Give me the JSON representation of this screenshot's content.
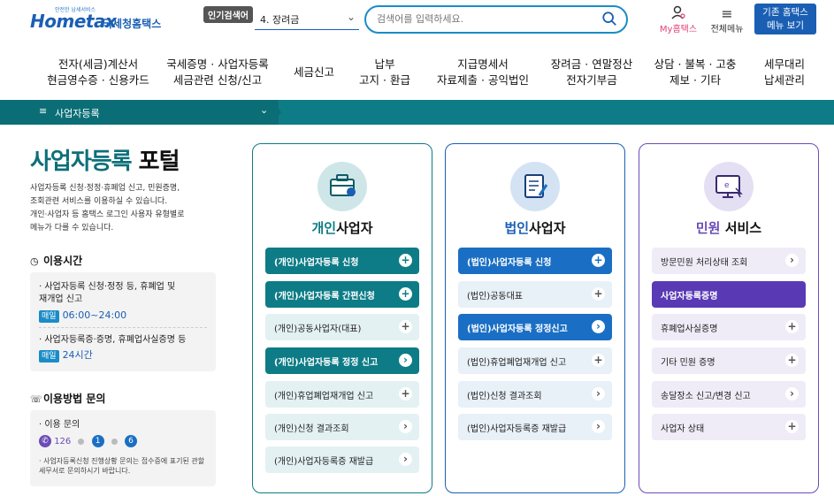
{
  "header": {
    "logo_tiny": "안전한 납세서비스",
    "logo_main": "Hometax",
    "logo_sub": "국세청홈택스",
    "popular_badge": "인기검색어",
    "popular_value": "4.  장려금",
    "search_placeholder": "검색어를 입력하세요.",
    "my_label": "My홈택스",
    "all_menu_label": "전체메뉴",
    "old_btn_line1": "기존 홈택스",
    "old_btn_line2": "메뉴 보기"
  },
  "gnb": [
    {
      "l1": "전자(세금)계산서",
      "l2": "현금영수증 · 신용카드"
    },
    {
      "l1": "국세증명 · 사업자등록",
      "l2": "세금관련 신청/신고"
    },
    {
      "l1": "세금신고",
      "l2": ""
    },
    {
      "l1": "납부",
      "l2": "고지 · 환급"
    },
    {
      "l1": "지급명세서",
      "l2": "자료제출 · 공익법인"
    },
    {
      "l1": "장려금 · 연말정산",
      "l2": "전자기부금"
    },
    {
      "l1": "상담 · 불복 · 고충",
      "l2": "제보 · 기타"
    },
    {
      "l1": "세무대리",
      "l2": "납세관리"
    }
  ],
  "breadcrumb": "사업자등록",
  "left": {
    "title_a": "사업자등록",
    "title_b": " 포털",
    "desc": [
      "사업자등록 신청·정정·휴폐업 신고, 민원증명,",
      "조회관련 서비스를 이용하실 수 있습니다.",
      "개인·사업자 등 홈택스 로그인 사용자 유형별로",
      "메뉴가 다를 수 있습니다."
    ],
    "hours_title": "이용시간",
    "hours_item1_a": "· 사업자등록 신청·정정 등, 휴폐업 및",
    "hours_item1_b": "  재개업 신고",
    "hours_tag1": "매일",
    "hours_time1": "06:00~24:00",
    "hours_item2": "· 사업자등록증·증명, 휴폐업사실증명 등",
    "hours_tag2": "매일",
    "hours_time2": "24시간",
    "contact_title": "이용방법 문의",
    "contact_item": "· 이용 문의",
    "contact_num1": "126",
    "contact_num2": "1",
    "contact_num3": "6",
    "contact_note": "· 사업자등록신청 진행상황 문의는 접수증에 표기된 관할 세무서로 문의하시기 바랍니다."
  },
  "cards": [
    {
      "title_hl": "개인",
      "title_rest": "사업자",
      "buttons": [
        {
          "label": "(개인)사업자등록 신청",
          "style": "solid-t",
          "icon": "+"
        },
        {
          "label": "(개인)사업자등록 간편신청",
          "style": "solid-t",
          "icon": "+"
        },
        {
          "label": "(개인)공동사업자(대표)",
          "style": "light-t",
          "icon": "+"
        },
        {
          "label": "(개인)사업자등록 정정 신고",
          "style": "solid-t",
          "icon": "›"
        },
        {
          "label": "(개인)휴업폐업재개업 신고",
          "style": "light-t",
          "icon": "+"
        },
        {
          "label": "(개인)신청 결과조회",
          "style": "light-t",
          "icon": "›"
        },
        {
          "label": "(개인)사업자등록증 재발급",
          "style": "light-t",
          "icon": "›"
        }
      ]
    },
    {
      "title_hl": "법인",
      "title_rest": "사업자",
      "buttons": [
        {
          "label": "(법인)사업자등록 신청",
          "style": "solid-b",
          "icon": "+"
        },
        {
          "label": "(법인)공동대표",
          "style": "light-b",
          "icon": "+"
        },
        {
          "label": "(법인)사업자등록 정정신고",
          "style": "solid-b",
          "icon": "›"
        },
        {
          "label": "(법인)휴업폐업재개업 신고",
          "style": "light-b",
          "icon": "+"
        },
        {
          "label": "(법인)신청 결과조회",
          "style": "light-b",
          "icon": "›"
        },
        {
          "label": "(법인)사업자등록증 재발급",
          "style": "light-b",
          "icon": "›"
        }
      ]
    },
    {
      "title_hl": "민원",
      "title_rest": " 서비스",
      "buttons": [
        {
          "label": "방문민원 처리상태 조회",
          "style": "light-p",
          "icon": "›"
        },
        {
          "label": "사업자등록증명",
          "style": "solid-p",
          "icon": ""
        },
        {
          "label": "휴폐업사실증명",
          "style": "light-p",
          "icon": "+"
        },
        {
          "label": "기타 민원 증명",
          "style": "light-p",
          "icon": "+"
        },
        {
          "label": "송달장소 신고/변경 신고",
          "style": "light-p",
          "icon": "›"
        },
        {
          "label": "사업자 상태",
          "style": "light-p",
          "icon": "+"
        }
      ]
    }
  ],
  "colors": {
    "teal": "#0d7c86",
    "blue": "#1a5fb4",
    "purple": "#5a3ab4"
  }
}
